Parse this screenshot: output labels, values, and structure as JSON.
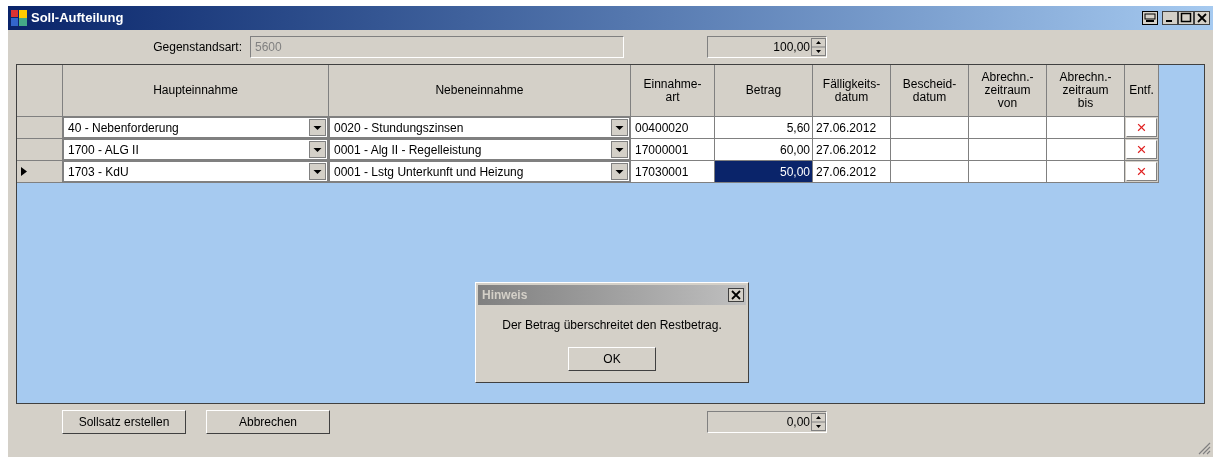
{
  "window": {
    "title": "Soll-Aufteilung"
  },
  "gegenstandsart": {
    "label": "Gegenstandsart:",
    "value": "5600",
    "disabled": true
  },
  "total_spin": {
    "value": "100,00"
  },
  "table": {
    "columns": [
      "",
      "Haupteinnahme",
      "Nebeneinnahme",
      "Einnahme-art",
      "Betrag",
      "Fälligkeits-datum",
      "Bescheid-datum",
      "Abrechn.-zeitraum von",
      "Abrechn.-zeitraum bis",
      "Entf."
    ],
    "rows": [
      {
        "selected": false,
        "haupteinnahme": "40 - Nebenforderung",
        "nebeneinnahme": "0020 - Stundungszinsen",
        "einnahmeart": "00400020",
        "betrag": "5,60",
        "faelligkeit": "27.06.2012",
        "entf": "×"
      },
      {
        "selected": false,
        "haupteinnahme": "1700 - ALG II",
        "nebeneinnahme": "0001 - Alg II - Regelleistung",
        "einnahmeart": "17000001",
        "betrag": "60,00",
        "faelligkeit": "27.06.2012",
        "entf": "×"
      },
      {
        "selected": true,
        "haupteinnahme": "1703 - KdU",
        "nebeneinnahme": "0001 - Lstg Unterkunft und Heizung",
        "einnahmeart": "17030001",
        "betrag": "50,00",
        "faelligkeit": "27.06.2012",
        "entf": "×"
      }
    ]
  },
  "dialog": {
    "title": "Hinweis",
    "message": "Der Betrag überschreitet den Restbetrag.",
    "button": "OK"
  },
  "buttons": [
    "Sollsatz erstellen",
    "Abbrechen"
  ],
  "rest_spin": {
    "value": "0,00"
  }
}
